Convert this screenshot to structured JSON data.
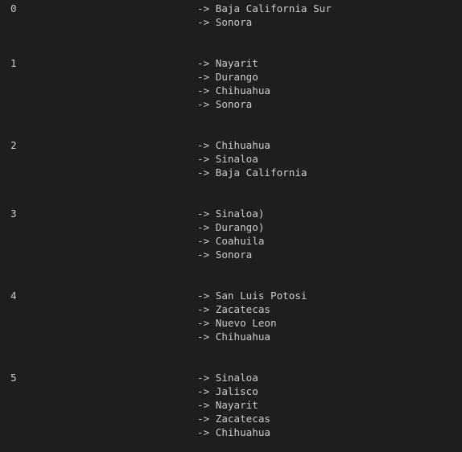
{
  "terminal": {
    "arrow": "->",
    "groups": [
      {
        "index": "0",
        "items": [
          "Baja California Sur",
          "Sonora"
        ]
      },
      {
        "index": "1",
        "items": [
          "Nayarit",
          "Durango",
          "Chihuahua",
          "Sonora"
        ]
      },
      {
        "index": "2",
        "items": [
          "Chihuahua",
          "Sinaloa",
          "Baja California"
        ]
      },
      {
        "index": "3",
        "items": [
          "Sinaloa)",
          "Durango)",
          "Coahuila",
          "Sonora"
        ]
      },
      {
        "index": "4",
        "items": [
          "San Luis Potosi",
          "Zacatecas",
          "Nuevo Leon",
          "Chihuahua"
        ]
      },
      {
        "index": "5",
        "items": [
          "Sinaloa",
          "Jalisco",
          "Nayarit",
          "Zacatecas",
          "Chihuahua"
        ]
      }
    ]
  }
}
